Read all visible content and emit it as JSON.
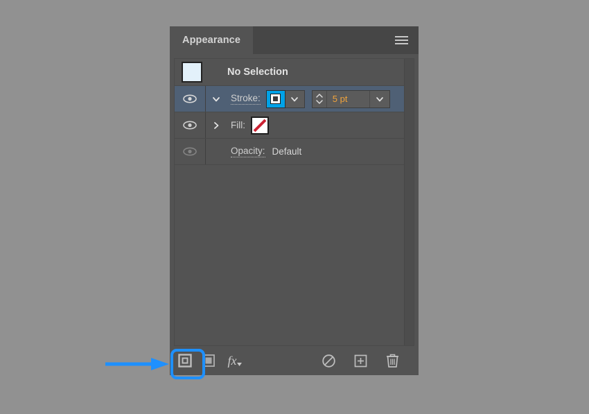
{
  "panel": {
    "tab_label": "Appearance",
    "menu_icon": "hamburger-menu-icon",
    "header": {
      "thumbnail_icon": "artwork-thumbnail-swatch",
      "title": "No Selection"
    },
    "rows": [
      {
        "id": "stroke",
        "visibility_icon": "eye-icon",
        "disclosure_icon": "chevron-down-icon",
        "label": "Stroke:",
        "color_swatch_icon": "stroke-color-swatch",
        "color_dropdown_icon": "chevron-down-icon",
        "stepper_icon": "stepper-up-down-icon",
        "weight_value": "5 pt",
        "unit_dropdown_icon": "chevron-down-icon",
        "selected": true
      },
      {
        "id": "fill",
        "visibility_icon": "eye-icon",
        "disclosure_icon": "chevron-right-icon",
        "label": "Fill:",
        "color_swatch_icon": "none-swatch-icon",
        "selected": false
      },
      {
        "id": "opacity",
        "visibility_icon": "eye-icon-dimmed",
        "label": "Opacity:",
        "value": "Default",
        "selected": false
      }
    ],
    "footer": {
      "buttons": [
        {
          "id": "add-new-stroke",
          "icon": "add-new-stroke-icon",
          "highlighted": true
        },
        {
          "id": "add-new-fill",
          "icon": "add-new-fill-icon",
          "highlighted": false
        },
        {
          "id": "add-new-effect",
          "icon": "fx-icon",
          "label": "fx",
          "highlighted": false
        },
        {
          "id": "clear-appearance",
          "icon": "clear-appearance-icon",
          "highlighted": false
        },
        {
          "id": "duplicate-item",
          "icon": "duplicate-plus-icon",
          "highlighted": false
        },
        {
          "id": "delete-item",
          "icon": "trash-icon",
          "highlighted": false
        }
      ]
    }
  },
  "annotation": {
    "arrow_icon": "arrow-right-annotation",
    "arrow_color": "#1e90ff",
    "highlight_color": "#1e90ff",
    "target": "add-new-stroke"
  },
  "colors": {
    "canvas_background": "#919191",
    "panel_background": "#535353",
    "tabbar_background": "#464646",
    "row_selected": "#4f6075",
    "accent_swatch": "#00a2e8",
    "value_text": "#f0a33c",
    "none_slash": "#cc2233"
  }
}
